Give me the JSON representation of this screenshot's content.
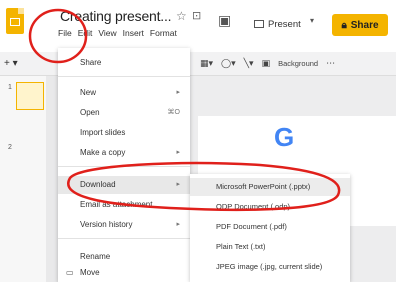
{
  "app": {
    "title": "Creating present...",
    "star_icon": "star-outline-icon",
    "move_icon": "folder-move-icon"
  },
  "menubar": [
    "File",
    "Edit",
    "View",
    "Insert",
    "Format"
  ],
  "top_actions": {
    "present_label": "Present",
    "share_label": "Share"
  },
  "toolbar": {
    "background_label": "Background"
  },
  "filmstrip": {
    "slide_numbers": [
      "1",
      "2"
    ]
  },
  "file_menu": {
    "items": [
      {
        "label": "Share"
      },
      {
        "label": "New",
        "right": "▸"
      },
      {
        "label": "Open",
        "right": "⌘O"
      },
      {
        "label": "Import slides"
      },
      {
        "label": "Make a copy",
        "right": "▸"
      },
      {
        "label": "Download",
        "right": "▸"
      },
      {
        "label": "Email as attachment"
      },
      {
        "label": "Version history",
        "right": "▸"
      },
      {
        "label": "Rename"
      },
      {
        "label": "Move"
      }
    ]
  },
  "download_submenu": {
    "items": [
      {
        "label": "Microsoft PowerPoint (.pptx)"
      },
      {
        "label": "ODP Document (.odp)"
      },
      {
        "label": "PDF Document (.pdf)"
      },
      {
        "label": "Plain Text (.txt)"
      },
      {
        "label": "JPEG image (.jpg, current slide)"
      }
    ]
  },
  "colors": {
    "accent": "#f4b400",
    "annotation": "#e0201b"
  }
}
